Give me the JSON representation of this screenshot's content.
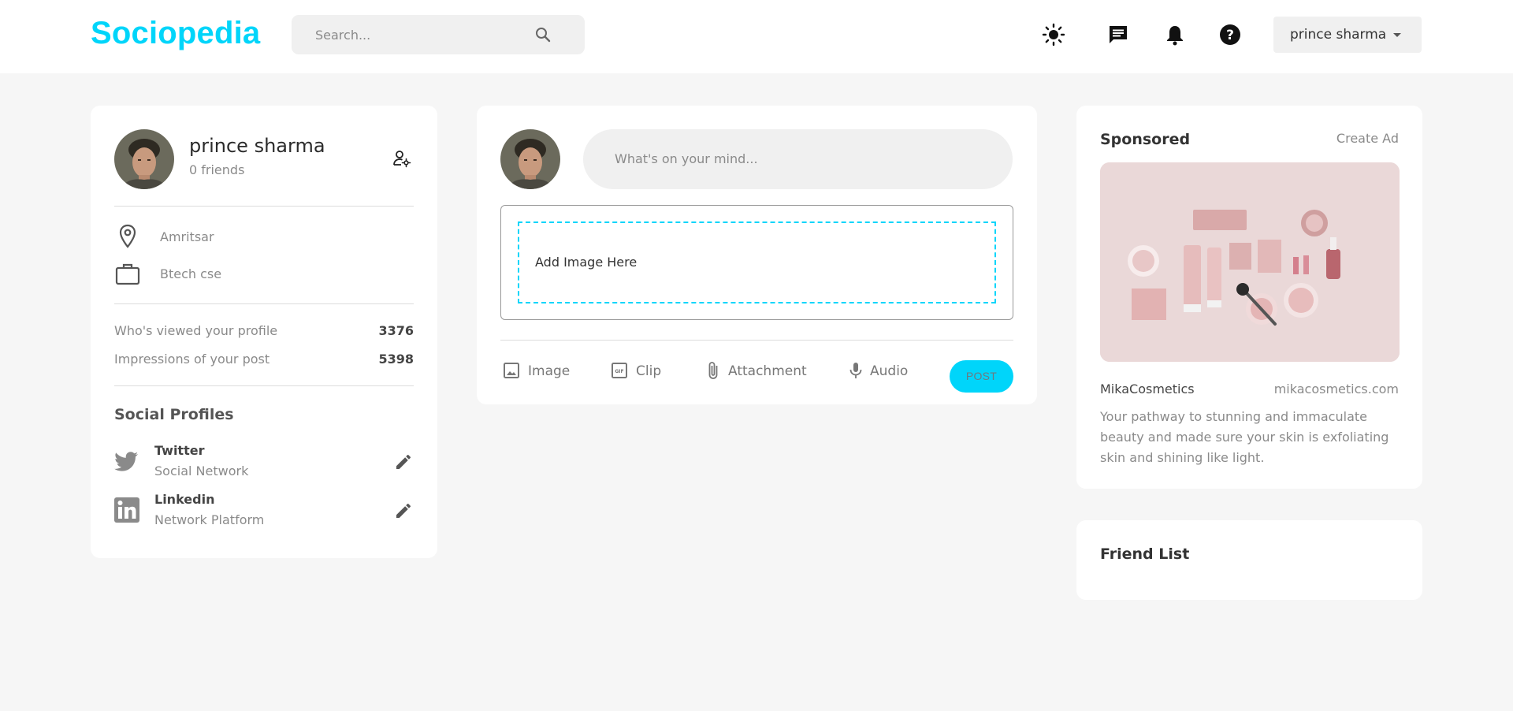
{
  "app": {
    "logo": "Sociopedia",
    "search_placeholder": "Search...",
    "user_menu_name": "prince sharma"
  },
  "icons": {
    "search": "search-icon",
    "theme": "sun-icon",
    "messages": "message-icon",
    "notifications": "bell-icon",
    "help": "help-icon"
  },
  "colors": {
    "brand": "#00d5fa",
    "background": "#f6f6f6",
    "card": "#ffffff",
    "muted_text": "#8a8a8a"
  },
  "profile": {
    "name": "prince sharma",
    "friends": "0 friends",
    "location": "Amritsar",
    "occupation": "Btech cse",
    "stats": [
      {
        "label": "Who's viewed your profile",
        "value": "3376"
      },
      {
        "label": "Impressions of your post",
        "value": "5398"
      }
    ],
    "social_title": "Social Profiles",
    "socials": [
      {
        "name": "Twitter",
        "subtitle": "Social Network",
        "icon": "twitter-icon"
      },
      {
        "name": "Linkedin",
        "subtitle": "Network Platform",
        "icon": "linkedin-icon"
      }
    ]
  },
  "post": {
    "placeholder": "What's on your mind...",
    "dropzone_text": "Add Image Here",
    "actions": [
      {
        "label": "Image",
        "icon": "image-icon"
      },
      {
        "label": "Clip",
        "icon": "gif-icon"
      },
      {
        "label": "Attachment",
        "icon": "paperclip-icon"
      },
      {
        "label": "Audio",
        "icon": "microphone-icon"
      }
    ],
    "submit_label": "POST"
  },
  "sponsored": {
    "title": "Sponsored",
    "create_ad": "Create Ad",
    "advertiser": "MikaCosmetics",
    "website": "mikacosmetics.com",
    "description": "Your pathway to stunning and immaculate beauty and made sure your skin is exfoliating skin and shining like light."
  },
  "friend_list": {
    "title": "Friend List"
  }
}
